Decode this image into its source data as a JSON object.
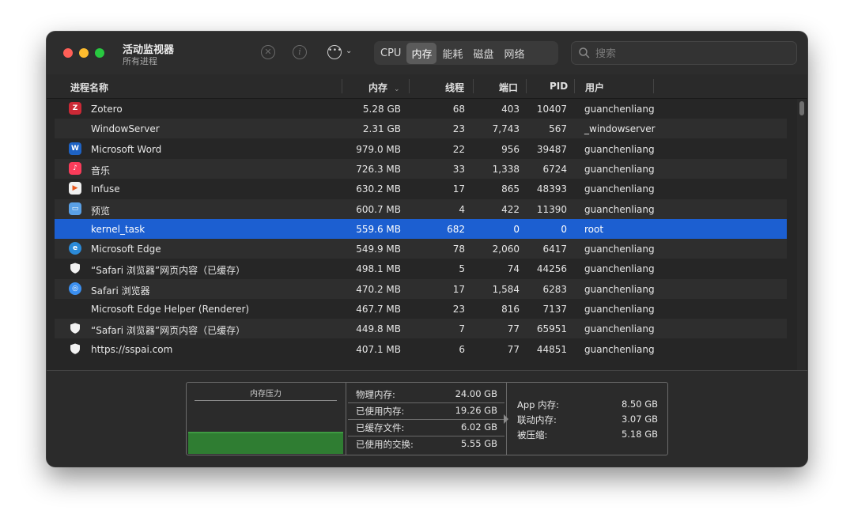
{
  "window": {
    "title": "活动监视器",
    "subtitle": "所有进程"
  },
  "toolbar": {
    "tabs": [
      {
        "label": "CPU",
        "active": false
      },
      {
        "label": "内存",
        "active": true
      },
      {
        "label": "能耗",
        "active": false
      },
      {
        "label": "磁盘",
        "active": false
      },
      {
        "label": "网络",
        "active": false
      }
    ],
    "search_placeholder": "搜索"
  },
  "columns": {
    "name": "进程名称",
    "memory": "内存",
    "threads": "线程",
    "ports": "端口",
    "pid": "PID",
    "user": "用户"
  },
  "processes": [
    {
      "name": "Zotero",
      "icon": "zotero-icon",
      "memory": "5.28 GB",
      "threads": "68",
      "ports": "403",
      "pid": "10407",
      "user": "guanchenliang"
    },
    {
      "name": "WindowServer",
      "icon": "",
      "memory": "2.31 GB",
      "threads": "23",
      "ports": "7,743",
      "pid": "567",
      "user": "_windowserver"
    },
    {
      "name": "Microsoft Word",
      "icon": "word-icon",
      "memory": "979.0 MB",
      "threads": "22",
      "ports": "956",
      "pid": "39487",
      "user": "guanchenliang"
    },
    {
      "name": "音乐",
      "icon": "music-icon",
      "memory": "726.3 MB",
      "threads": "33",
      "ports": "1,338",
      "pid": "6724",
      "user": "guanchenliang"
    },
    {
      "name": "Infuse",
      "icon": "infuse-icon",
      "memory": "630.2 MB",
      "threads": "17",
      "ports": "865",
      "pid": "48393",
      "user": "guanchenliang"
    },
    {
      "name": "预览",
      "icon": "preview-icon",
      "memory": "600.7 MB",
      "threads": "4",
      "ports": "422",
      "pid": "11390",
      "user": "guanchenliang"
    },
    {
      "name": "kernel_task",
      "icon": "",
      "memory": "559.6 MB",
      "threads": "682",
      "ports": "0",
      "pid": "0",
      "user": "root",
      "selected": true
    },
    {
      "name": "Microsoft Edge",
      "icon": "edge-icon",
      "memory": "549.9 MB",
      "threads": "78",
      "ports": "2,060",
      "pid": "6417",
      "user": "guanchenliang"
    },
    {
      "name": "“Safari 浏览器”网页内容（已缓存）",
      "icon": "shield-icon",
      "memory": "498.1 MB",
      "threads": "5",
      "ports": "74",
      "pid": "44256",
      "user": "guanchenliang"
    },
    {
      "name": "Safari 浏览器",
      "icon": "safari-icon",
      "memory": "470.2 MB",
      "threads": "17",
      "ports": "1,584",
      "pid": "6283",
      "user": "guanchenliang"
    },
    {
      "name": "Microsoft Edge Helper (Renderer)",
      "icon": "",
      "memory": "467.7 MB",
      "threads": "23",
      "ports": "816",
      "pid": "7137",
      "user": "guanchenliang"
    },
    {
      "name": "“Safari 浏览器”网页内容（已缓存）",
      "icon": "shield-icon",
      "memory": "449.8 MB",
      "threads": "7",
      "ports": "77",
      "pid": "65951",
      "user": "guanchenliang"
    },
    {
      "name": "https://sspai.com",
      "icon": "shield-icon",
      "memory": "407.1 MB",
      "threads": "6",
      "ports": "77",
      "pid": "44851",
      "user": "guanchenliang"
    }
  ],
  "memory_panel": {
    "pressure_label": "内存压力",
    "stats": [
      {
        "label": "物理内存:",
        "value": "24.00 GB"
      },
      {
        "label": "已使用内存:",
        "value": "19.26 GB"
      },
      {
        "label": "已缓存文件:",
        "value": "6.02 GB"
      },
      {
        "label": "已使用的交换:",
        "value": "5.55 GB"
      }
    ],
    "breakdown": [
      {
        "label": "App 内存:",
        "value": "8.50 GB"
      },
      {
        "label": "联动内存:",
        "value": "3.07 GB"
      },
      {
        "label": "被压缩:",
        "value": "5.18 GB"
      }
    ]
  },
  "colors": {
    "selection": "#1c5fd1",
    "pressure_green": "#2f7d32"
  }
}
